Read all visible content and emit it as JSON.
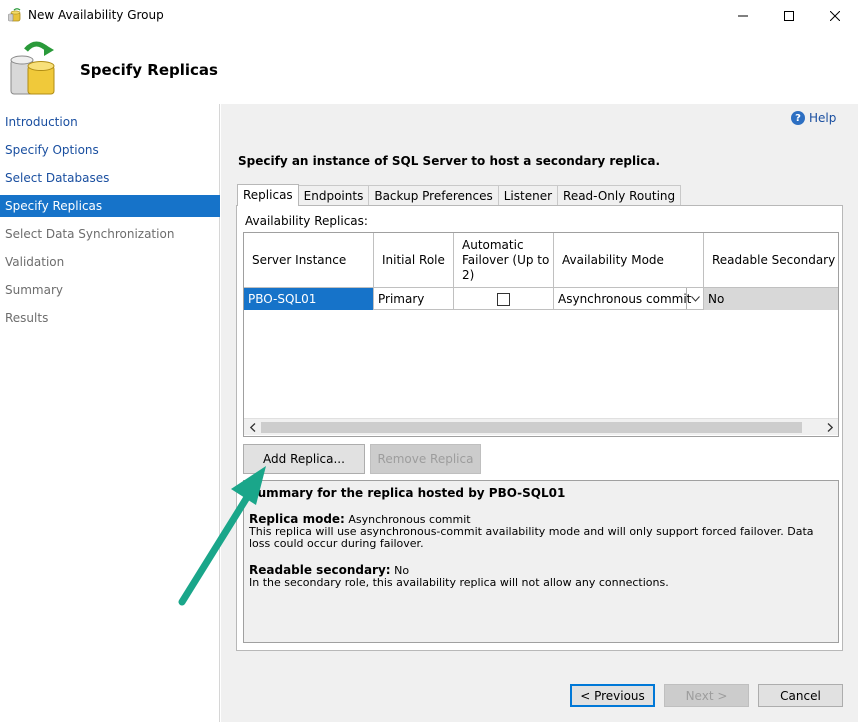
{
  "window": {
    "title": "New Availability Group"
  },
  "header": {
    "title": "Specify Replicas"
  },
  "sidebar": {
    "items": [
      {
        "label": "Introduction",
        "state": "link"
      },
      {
        "label": "Specify Options",
        "state": "link"
      },
      {
        "label": "Select Databases",
        "state": "link"
      },
      {
        "label": "Specify Replicas",
        "state": "active"
      },
      {
        "label": "Select Data Synchronization",
        "state": "disabled"
      },
      {
        "label": "Validation",
        "state": "disabled"
      },
      {
        "label": "Summary",
        "state": "disabled"
      },
      {
        "label": "Results",
        "state": "disabled"
      }
    ]
  },
  "main": {
    "help_label": "Help",
    "instruction": "Specify an instance of SQL Server to host a secondary replica.",
    "tabs": [
      "Replicas",
      "Endpoints",
      "Backup Preferences",
      "Listener",
      "Read-Only Routing"
    ],
    "availability_replicas_label": "Availability Replicas:",
    "grid": {
      "columns": [
        "Server Instance",
        "Initial Role",
        "Automatic Failover (Up to 2)",
        "Availability Mode",
        "Readable Secondary"
      ],
      "rows": [
        {
          "server_instance": "PBO-SQL01",
          "initial_role": "Primary",
          "automatic_failover": false,
          "availability_mode": "Asynchronous commit",
          "readable_secondary": "No"
        }
      ]
    },
    "add_replica_label": "Add Replica...",
    "remove_replica_label": "Remove Replica",
    "summary": {
      "title": "Summary for the replica hosted by PBO-SQL01",
      "replica_mode_label": "Replica mode:",
      "replica_mode_value": "Asynchronous commit",
      "replica_mode_desc": "This replica will use asynchronous-commit availability mode and will only support forced failover. Data loss could occur during failover.",
      "readable_secondary_label": "Readable secondary:",
      "readable_secondary_value": "No",
      "readable_secondary_desc": "In the secondary role, this availability replica will not allow any connections."
    }
  },
  "footer": {
    "previous_label": "< Previous",
    "next_label": "Next >",
    "cancel_label": "Cancel"
  },
  "colors": {
    "accent": "#1673c9",
    "annotation_arrow": "#1aa68a"
  }
}
